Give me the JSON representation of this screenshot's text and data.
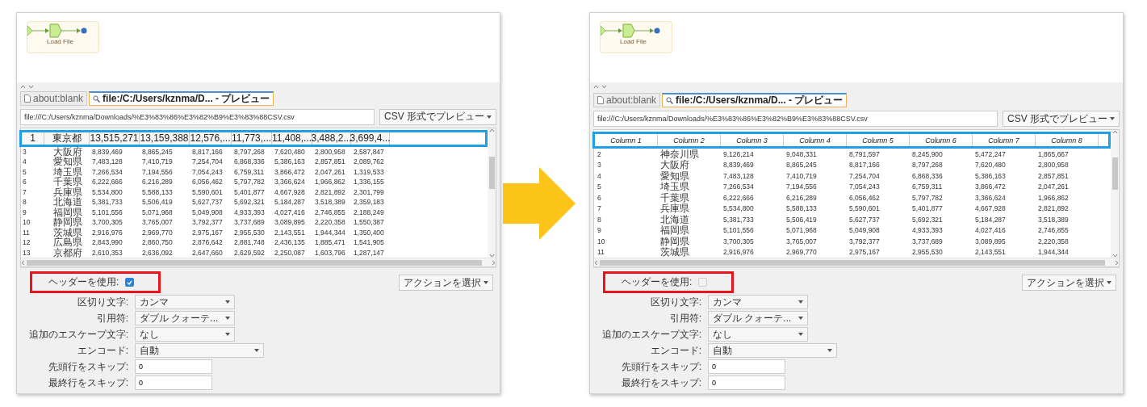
{
  "panels": [
    {
      "diagram": {
        "node_label": "Load File"
      },
      "tabs": [
        {
          "label": "about:blank",
          "kind": "page",
          "selected": false
        },
        {
          "label": "file:/C:/Users/kznma/D... - プレビュー",
          "kind": "search",
          "selected": true
        }
      ],
      "url": "file:///C:/Users/kznma/Downloads/%E3%83%86%E3%82%B9%E3%83%88CSV.csv",
      "preview_button": "CSV 形式でプレビュー",
      "table": {
        "kind": "first_row_header",
        "header": [
          "1",
          "東京都",
          "13,515,271",
          "13,159,388",
          "12,576,...",
          "11,773,...",
          "11,408,...",
          "3,488,2...",
          "3,699,4..."
        ],
        "rows": [
          [
            "3",
            "大阪府",
            "8,839,469",
            "8,865,245",
            "8,817,166",
            "8,797,268",
            "7,620,480",
            "2,800,958",
            "2,587,847"
          ],
          [
            "4",
            "愛知県",
            "7,483,128",
            "7,410,719",
            "7,254,704",
            "6,868,336",
            "5,386,163",
            "2,857,851",
            "2,089,762"
          ],
          [
            "5",
            "埼玉県",
            "7,266,534",
            "7,194,556",
            "7,054,243",
            "6,759,311",
            "3,866,472",
            "2,047,261",
            "1,319,533"
          ],
          [
            "6",
            "千葉県",
            "6,222,666",
            "6,216,289",
            "6,056,462",
            "5,797,782",
            "3,366,624",
            "1,966,862",
            "1,336,155"
          ],
          [
            "7",
            "兵庫県",
            "5,534,800",
            "5,588,133",
            "5,590,601",
            "5,401,877",
            "4,667,928",
            "2,821,892",
            "2,301,799"
          ],
          [
            "8",
            "北海道",
            "5,381,733",
            "5,506,419",
            "5,627,737",
            "5,692,321",
            "5,184,287",
            "3,518,389",
            "2,359,183"
          ],
          [
            "9",
            "福岡県",
            "5,101,556",
            "5,071,968",
            "5,049,908",
            "4,933,393",
            "4,027,416",
            "2,746,855",
            "2,188,249"
          ],
          [
            "10",
            "静岡県",
            "3,700,305",
            "3,765,007",
            "3,792,377",
            "3,737,689",
            "3,089,895",
            "2,220,358",
            "1,550,387"
          ],
          [
            "11",
            "茨城県",
            "2,916,976",
            "2,969,770",
            "2,975,167",
            "2,955,530",
            "2,143,551",
            "1,944,344",
            "1,350,400"
          ],
          [
            "12",
            "広島県",
            "2,843,990",
            "2,860,750",
            "2,876,642",
            "2,881,748",
            "2,436,135",
            "1,885,471",
            "1,541,905"
          ],
          [
            "13",
            "京都府",
            "2,610,353",
            "2,636,092",
            "2,647,660",
            "2,629,592",
            "2,250,087",
            "1,603,796",
            "1,287,147"
          ]
        ]
      },
      "action_button": "アクションを選択",
      "form": [
        {
          "kind": "checkbox",
          "label": "ヘッダーを使用:",
          "checked": true
        },
        {
          "kind": "select",
          "label": "区切り文字:",
          "value": "カンマ"
        },
        {
          "kind": "select",
          "label": "引用符:",
          "value": "ダブル クォーテ..."
        },
        {
          "kind": "select",
          "label": "追加のエスケープ文字:",
          "value": "なし"
        },
        {
          "kind": "select_wide",
          "label": "エンコード:",
          "value": "自動"
        },
        {
          "kind": "text",
          "label": "先頭行をスキップ:",
          "value": "0"
        },
        {
          "kind": "text",
          "label": "最終行をスキップ:",
          "value": "0"
        }
      ]
    },
    {
      "diagram": {
        "node_label": "Load File"
      },
      "tabs": [
        {
          "label": "about:blank",
          "kind": "page",
          "selected": false
        },
        {
          "label": "file:/C:/Users/kznma/D... - プレビュー",
          "kind": "search",
          "selected": true
        }
      ],
      "url": "file:///C:/Users/kznma/Downloads/%E3%83%86%E3%82%B9%E3%83%88CSV.csv",
      "preview_button": "CSV 形式でプレビュー",
      "table": {
        "kind": "generated_header",
        "header": [
          "Column 1",
          "Column 2",
          "Column 3",
          "Column 4",
          "Column 5",
          "Column 6",
          "Column 7",
          "Column 8"
        ],
        "rows": [
          [
            "2",
            "神奈川県",
            "9,126,214",
            "9,048,331",
            "8,791,597",
            "8,245,900",
            "5,472,247",
            "1,865,667"
          ],
          [
            "3",
            "大阪府",
            "8,839,469",
            "8,865,245",
            "8,817,166",
            "8,797,268",
            "7,620,480",
            "2,800,958"
          ],
          [
            "4",
            "愛知県",
            "7,483,128",
            "7,410,719",
            "7,254,704",
            "6,868,336",
            "5,386,163",
            "2,857,851"
          ],
          [
            "5",
            "埼玉県",
            "7,266,534",
            "7,194,556",
            "7,054,243",
            "6,759,311",
            "3,866,472",
            "2,047,261"
          ],
          [
            "6",
            "千葉県",
            "6,222,666",
            "6,216,289",
            "6,056,462",
            "5,797,782",
            "3,366,624",
            "1,966,862"
          ],
          [
            "7",
            "兵庫県",
            "5,534,800",
            "5,588,133",
            "5,590,601",
            "5,401,877",
            "4,667,928",
            "2,821,892"
          ],
          [
            "8",
            "北海道",
            "5,381,733",
            "5,506,419",
            "5,627,737",
            "5,692,321",
            "5,184,287",
            "3,518,389"
          ],
          [
            "9",
            "福岡県",
            "5,101,556",
            "5,071,968",
            "5,049,908",
            "4,933,393",
            "4,027,416",
            "2,746,855"
          ],
          [
            "10",
            "静岡県",
            "3,700,305",
            "3,765,007",
            "3,792,377",
            "3,737,689",
            "3,089,895",
            "2,220,358"
          ],
          [
            "11",
            "茨城県",
            "2,916,976",
            "2,969,770",
            "2,975,167",
            "2,955,530",
            "2,143,551",
            "1,944,344"
          ]
        ]
      },
      "action_button": "アクションを選択",
      "form": [
        {
          "kind": "checkbox",
          "label": "ヘッダーを使用:",
          "checked": false
        },
        {
          "kind": "select",
          "label": "区切り文字:",
          "value": "カンマ"
        },
        {
          "kind": "select",
          "label": "引用符:",
          "value": "ダブル クォーテ..."
        },
        {
          "kind": "select",
          "label": "追加のエスケープ文字:",
          "value": "なし"
        },
        {
          "kind": "select_wide",
          "label": "エンコード:",
          "value": "自動"
        },
        {
          "kind": "text",
          "label": "先頭行をスキップ:",
          "value": "0"
        },
        {
          "kind": "text",
          "label": "最終行をスキップ:",
          "value": "0"
        }
      ]
    }
  ]
}
